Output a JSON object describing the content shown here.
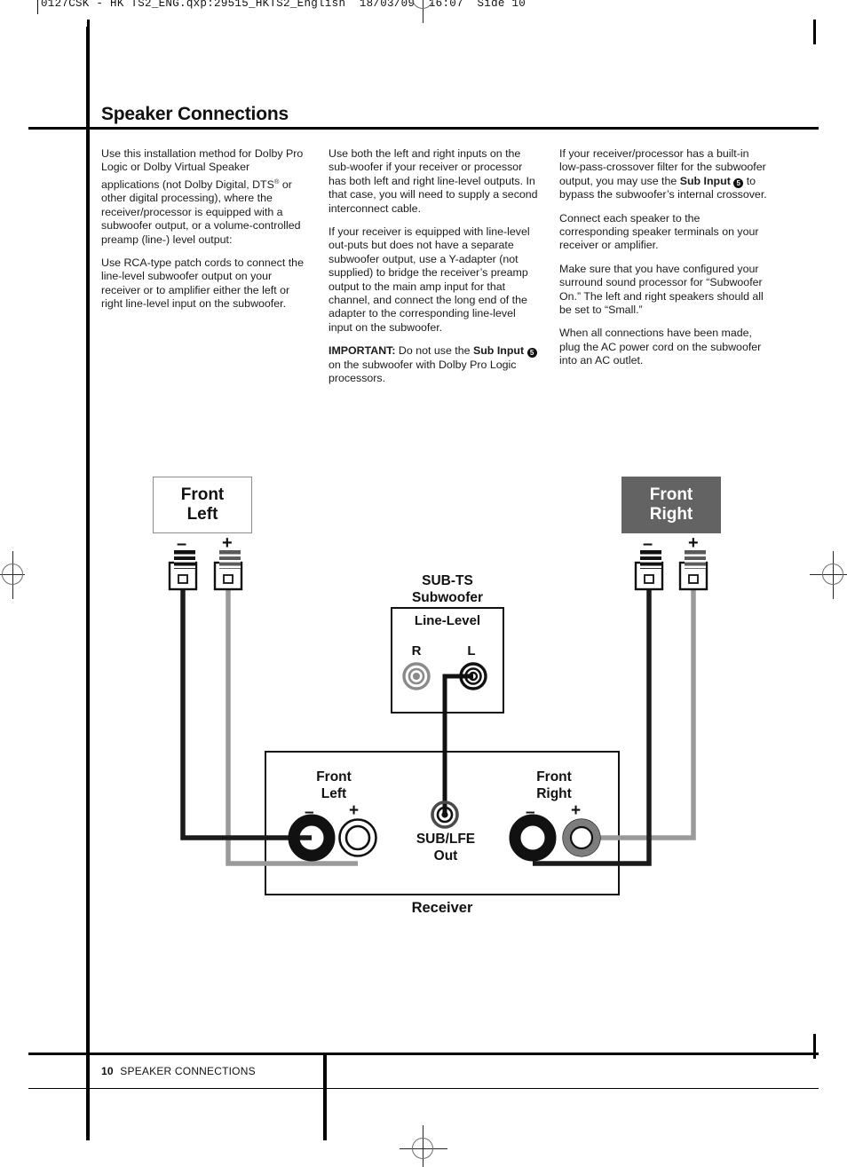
{
  "print_marks": {
    "slug": "0127CSK - HK TS2_ENG.qxp:29515_HKTS2_English  18/03/09  16:07  Side 10"
  },
  "header": {
    "title": "Speaker Connections"
  },
  "columns": [
    {
      "id": "column-1",
      "paragraphs": [
        {
          "runs": [
            {
              "text": "Use this installation method for Dolby Pro Logic or Dolby Virtual Speaker applications (not Dolby Digital, DTS"
            },
            {
              "text": "®",
              "style": "sup"
            },
            {
              "text": " or other digital processing), where the receiver/processor is equipped with a subwoofer output, or a volume-controlled preamp (line-) level output:"
            }
          ]
        },
        {
          "runs": [
            {
              "text": "Use RCA-type patch cords to connect the line-level subwoofer output on your receiver or to amplifier either the left or right line-level input on the subwoofer."
            }
          ]
        }
      ]
    },
    {
      "id": "column-2",
      "paragraphs": [
        {
          "runs": [
            {
              "text": "Use both the left and right inputs on the sub-woofer if your receiver or processor has both left and right line-level outputs. In that case, you will need to supply a second interconnect cable."
            }
          ]
        },
        {
          "runs": [
            {
              "text": "If your receiver is equipped with line-level out-puts but does not have a separate subwoofer output, use a Y-adapter (not supplied) to bridge the receiver’s preamp output to the main amp input for that channel, and connect the long end of the adapter to the corresponding line-level input on the subwoofer."
            }
          ]
        },
        {
          "runs": [
            {
              "text": "IMPORTANT:",
              "style": "bold"
            },
            {
              "text": " Do not use the "
            },
            {
              "text": "Sub Input",
              "style": "bold"
            },
            {
              "text": " "
            },
            {
              "text": "5",
              "style": "circled-number"
            },
            {
              "text": " on the subwoofer with Dolby Pro Logic processors."
            }
          ]
        }
      ]
    },
    {
      "id": "column-3",
      "paragraphs": [
        {
          "runs": [
            {
              "text": "If your receiver/processor has a built-in low-pass-crossover filter for the subwoofer output, you may use the "
            },
            {
              "text": "Sub Input",
              "style": "bold"
            },
            {
              "text": " "
            },
            {
              "text": "5",
              "style": "circled-number"
            },
            {
              "text": " to bypass the subwoofer’s internal crossover."
            }
          ]
        },
        {
          "runs": [
            {
              "text": "Connect each speaker to the corresponding speaker terminals on your receiver or amplifier."
            }
          ]
        },
        {
          "runs": [
            {
              "text": "Make sure that you have configured your surround sound processor for “Subwoofer On.” The left and right speakers should all be set to “Small.”"
            }
          ]
        },
        {
          "runs": [
            {
              "text": "When all connections have been made, plug the AC power cord on the subwoofer into an AC outlet."
            }
          ]
        }
      ]
    }
  ],
  "diagram": {
    "speaker_left": {
      "line1": "Front",
      "line2": "Left",
      "minus": "–",
      "plus": "+"
    },
    "speaker_right": {
      "line1": "Front",
      "line2": "Right",
      "minus": "–",
      "plus": "+"
    },
    "subwoofer": {
      "title_line1": "SUB-TS",
      "title_line2": "Subwoofer",
      "panel_label": "Line-Level",
      "jack_right": "R",
      "jack_left": "L"
    },
    "receiver": {
      "caption": "Receiver",
      "front_left_line1": "Front",
      "front_left_line2": "Left",
      "front_left_minus": "–",
      "front_left_plus": "+",
      "front_right_line1": "Front",
      "front_right_line2": "Right",
      "front_right_minus": "–",
      "front_right_plus": "+",
      "sub_out_line1": "SUB/LFE",
      "sub_out_line2": "Out"
    }
  },
  "footer": {
    "page_number": "10",
    "section": "SPEAKER CONNECTIONS"
  },
  "colors": {
    "ink": "#111111",
    "wire_black": "#1a1a1a",
    "wire_gray": "#9a9a9a",
    "panel_dark": "#636363",
    "jack_gray": "#6e6e6e"
  }
}
